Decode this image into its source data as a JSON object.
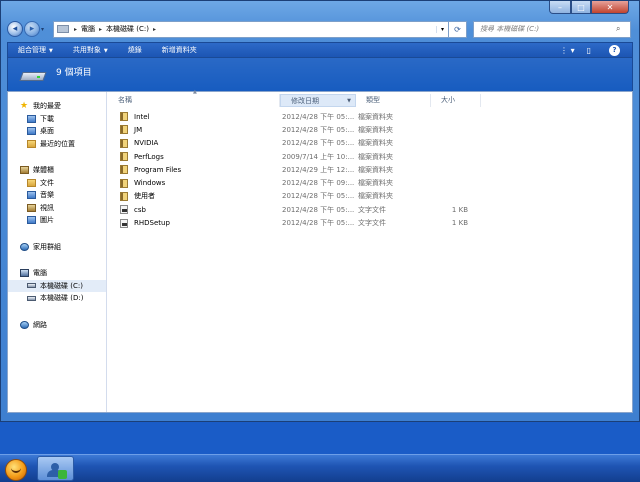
{
  "window": {
    "caption_buttons": {
      "minimize": "–",
      "maximize": "□",
      "close": "✕"
    }
  },
  "address_bar": {
    "segments": [
      "電腦",
      "本機磁碟 (C:)"
    ],
    "refresh_icon": "refresh-icon"
  },
  "search": {
    "placeholder": "搜尋 本機磁碟 (C:)"
  },
  "command_bar": {
    "organize": "組合管理",
    "share": "共用對象",
    "burn": "燒錄",
    "new_folder": "新增資料夾"
  },
  "details": {
    "item_count": "9 個項目"
  },
  "nav_pane": {
    "favorites": {
      "label": "我的最愛",
      "items": [
        "下載",
        "桌面",
        "最近的位置"
      ]
    },
    "libraries": {
      "label": "媒體櫃",
      "items": [
        "文件",
        "音樂",
        "視訊",
        "圖片"
      ]
    },
    "homegroup": {
      "label": "家用群組"
    },
    "computer": {
      "label": "電腦",
      "items": [
        "本機磁碟 (C:)",
        "本機磁碟 (D:)"
      ]
    },
    "network": {
      "label": "網路"
    }
  },
  "columns": {
    "name": "名稱",
    "date": "修改日期",
    "type": "類型",
    "size": "大小"
  },
  "files": [
    {
      "name": "Intel",
      "date": "2012/4/28 下午 05:...",
      "type": "檔案資料夾",
      "size": "",
      "kind": "folder"
    },
    {
      "name": "JM",
      "date": "2012/4/28 下午 05:...",
      "type": "檔案資料夾",
      "size": "",
      "kind": "folder"
    },
    {
      "name": "NVIDIA",
      "date": "2012/4/28 下午 05:...",
      "type": "檔案資料夾",
      "size": "",
      "kind": "folder"
    },
    {
      "name": "PerfLogs",
      "date": "2009/7/14 上午 10:...",
      "type": "檔案資料夾",
      "size": "",
      "kind": "folder"
    },
    {
      "name": "Program Files",
      "date": "2012/4/29 上午 12:...",
      "type": "檔案資料夾",
      "size": "",
      "kind": "folder"
    },
    {
      "name": "Windows",
      "date": "2012/4/28 下午 09:...",
      "type": "檔案資料夾",
      "size": "",
      "kind": "folder"
    },
    {
      "name": "使用者",
      "date": "2012/4/28 下午 05:...",
      "type": "檔案資料夾",
      "size": "",
      "kind": "folder"
    },
    {
      "name": "csb",
      "date": "2012/4/28 下午 05:...",
      "type": "文字文件",
      "size": "1 KB",
      "kind": "file"
    },
    {
      "name": "RHDSetup",
      "date": "2012/4/28 下午 05:...",
      "type": "文字文件",
      "size": "1 KB",
      "kind": "file"
    }
  ]
}
